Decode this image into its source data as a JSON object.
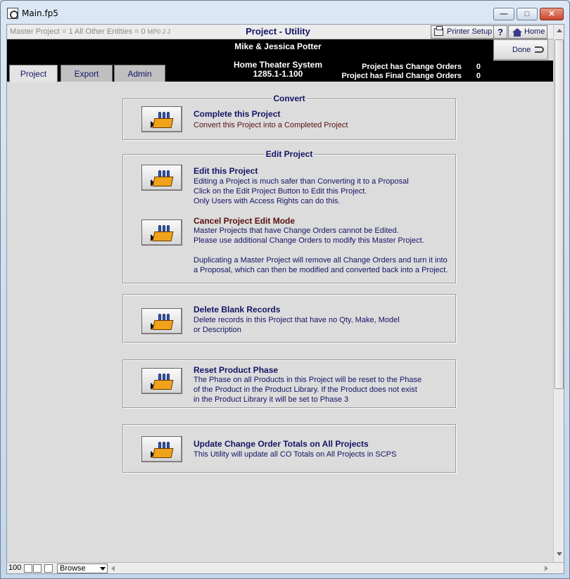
{
  "window": {
    "title": "Main.fp5",
    "min_label": "—",
    "max_label": "□",
    "close_label": "✕"
  },
  "header": {
    "stats": "Master Project = 1  All Other Entities = 0",
    "stats_small": "MP0   J      J",
    "title": "Project - Utility",
    "printer_setup": "Printer Setup",
    "help": "?",
    "home": "Home",
    "done": "Done",
    "customer": "Mike & Jessica Potter",
    "project_name": "Home Theater System",
    "project_number": "1285.1-1.100",
    "change_orders_label": "Project has Change Orders",
    "change_orders_value": "0",
    "final_change_orders_label": "Project has Final Change Orders",
    "final_change_orders_value": "0"
  },
  "tabs": [
    {
      "label": "Project",
      "active": true
    },
    {
      "label": "Export",
      "active": false
    },
    {
      "label": "Admin",
      "active": false
    }
  ],
  "sections": {
    "convert": {
      "legend": "Convert",
      "complete_title": "Complete this Project",
      "complete_desc": "Convert this Project into a Completed Project"
    },
    "edit": {
      "legend": "Edit Project",
      "edit_title": "Edit this Project",
      "edit_desc": [
        "Editing a Project is much safer than Converting it to a Proposal",
        "Click on the Edit Project Button to Edit this Project.",
        "Only Users with Access Rights can do this."
      ],
      "cancel_title": "Cancel Project Edit Mode",
      "cancel_desc": [
        "Master Projects that have Change Orders cannot be Edited.",
        "Please use additional Change Orders to modify this Master Project.",
        "",
        "Duplicating a Master Project will remove all Change Orders and turn it into",
        "a Proposal, which can then be modified and converted back into a Project."
      ]
    },
    "delete": {
      "title": "Delete Blank Records",
      "desc": [
        "Delete records in this Project that have no Qty, Make, Model",
        "or Description"
      ]
    },
    "reset": {
      "title": "Reset Product Phase",
      "desc": [
        "The Phase on all Products in this Project will be reset to the Phase",
        "of the Product in the Product Library. If the Product does not exist",
        "in the Product Library it will be set to Phase 3"
      ]
    },
    "update": {
      "title": "Update Change Order Totals on All Projects",
      "desc": "This Utility will update all CO Totals on All Projects in SCPS"
    }
  },
  "statusbar": {
    "zoom": "100",
    "mode": "Browse"
  },
  "icons": {
    "action_button_icon": "lego-brick-icon",
    "printer": "printer-icon",
    "home": "home-icon",
    "done": "return-arrow-icon"
  }
}
